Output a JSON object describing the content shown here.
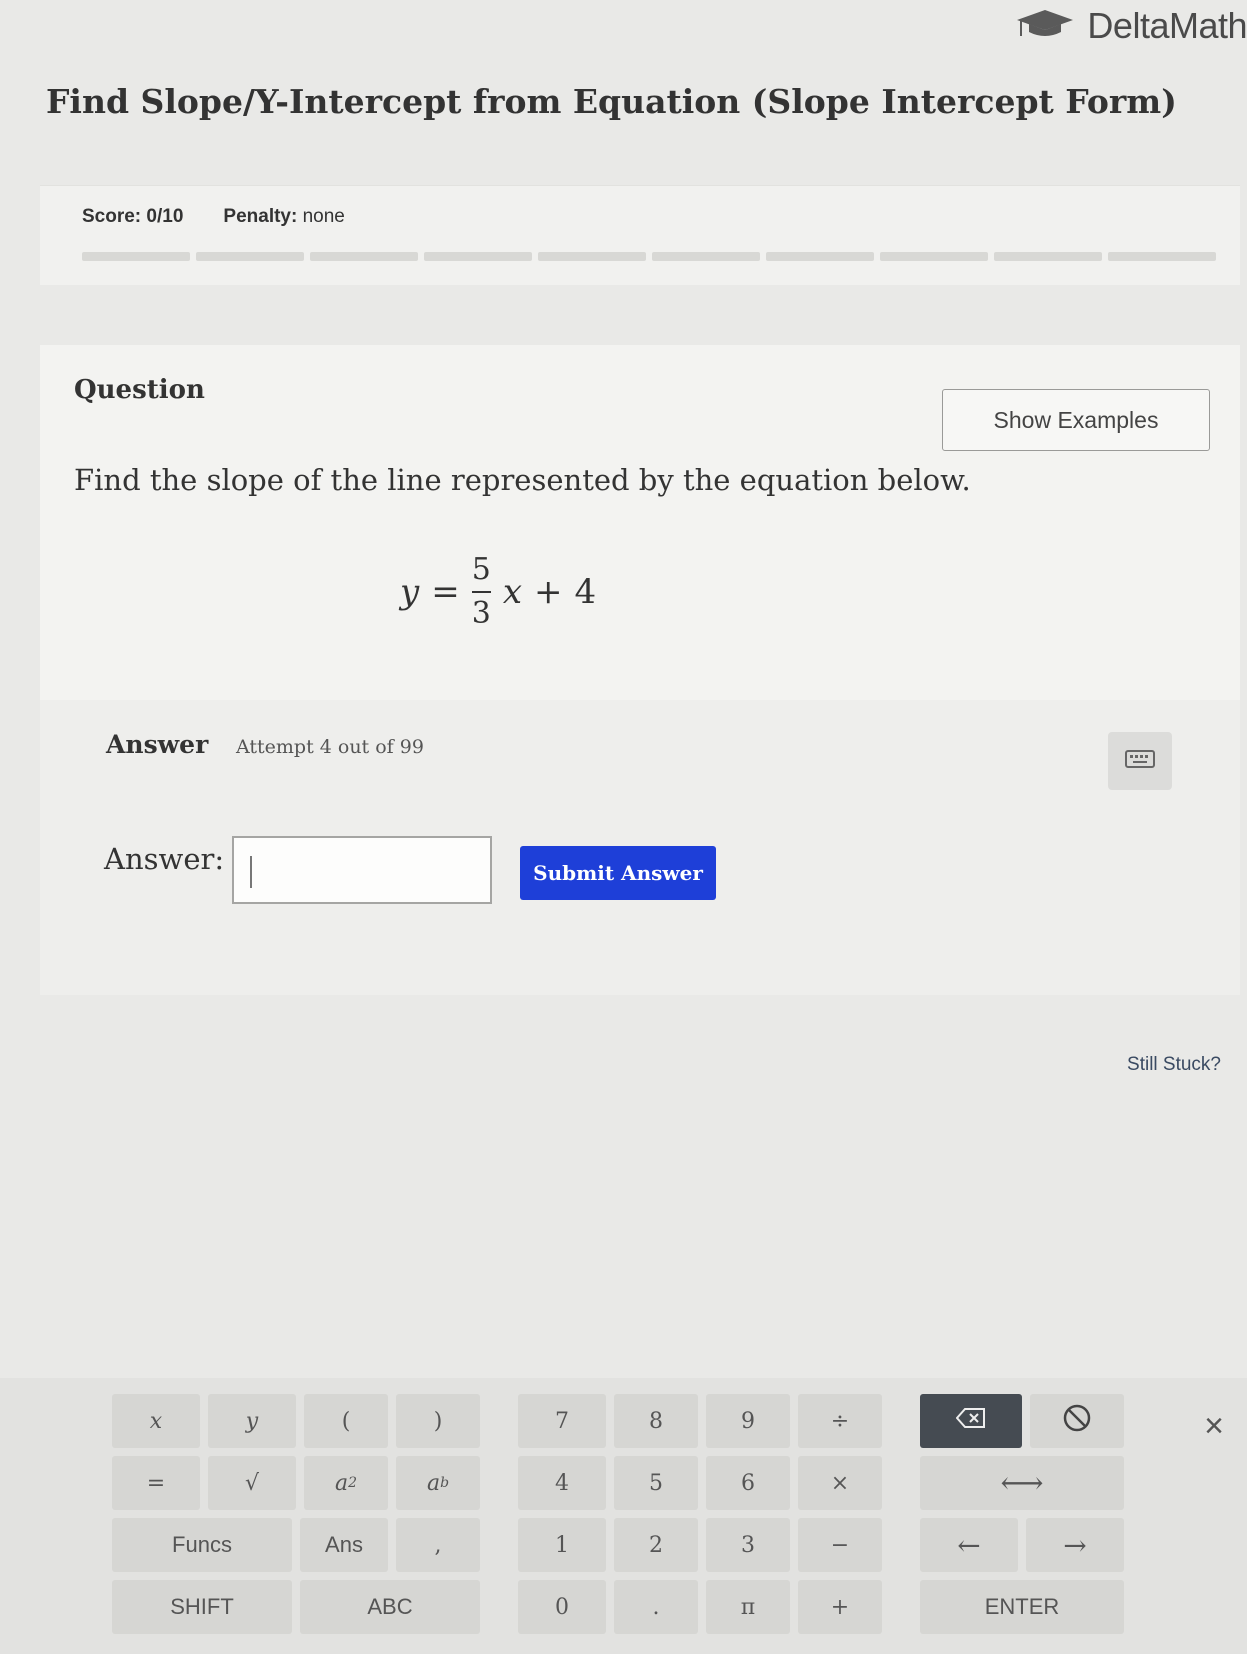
{
  "header": {
    "brand": "DeltaMath",
    "page_title": "Find Slope/Y-Intercept from Equation (Slope Intercept Form)"
  },
  "score": {
    "score_label": "Score: 0/10",
    "penalty_label": "Penalty:",
    "penalty_value": "none",
    "progress_segments": 10,
    "progress_completed": 0
  },
  "question": {
    "heading": "Question",
    "show_examples_label": "Show Examples",
    "prompt": "Find the slope of the line represented by the equation below.",
    "equation": {
      "lhs": "y",
      "equals": "=",
      "numerator": "5",
      "denominator": "3",
      "variable": "x",
      "plus": "+",
      "constant": "4"
    }
  },
  "answer": {
    "heading": "Answer",
    "attempt_text": "Attempt 4 out of 99",
    "label": "Answer:",
    "input_value": "",
    "submit_label": "Submit Answer"
  },
  "help": {
    "still_stuck": "Still Stuck?"
  },
  "keypad": {
    "row1": [
      "x",
      "y",
      "(",
      ")",
      "7",
      "8",
      "9",
      "÷"
    ],
    "row2": [
      "=",
      "√",
      "a",
      "a",
      "4",
      "5",
      "6",
      "×"
    ],
    "row2_superscripts": [
      "2",
      "b"
    ],
    "row3": [
      "Funcs",
      "Ans",
      ",",
      "1",
      "2",
      "3",
      "−"
    ],
    "row4": [
      "SHIFT",
      "ABC",
      "0",
      ".",
      "π",
      "+"
    ],
    "enter_label": "ENTER",
    "right_row3": [
      "←",
      "→"
    ],
    "right_row2": "⟷",
    "close_symbol": "×"
  },
  "colors": {
    "submit_button": "#1e3fd8",
    "backspace_key": "#454b52",
    "page_background": "#e9e9e7"
  }
}
